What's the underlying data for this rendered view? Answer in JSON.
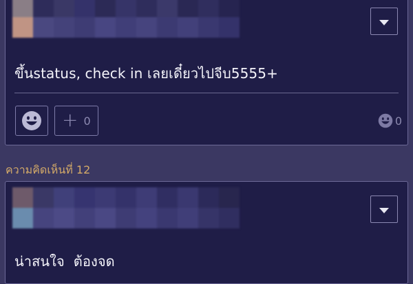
{
  "comment_1": {
    "author_blurred": true,
    "body": "ขึ้นstatus, check in เลยเดี๋ยวไปจีบ5555+",
    "plus_count": "0",
    "reaction_total": "0"
  },
  "comment_2": {
    "label": "ความคิดเห็นที่ 12",
    "author_blurred": true,
    "body": "น่าสนใจ  ต้องจด"
  },
  "icons": {
    "dropdown": "chevron-down-icon",
    "emoji": "smiley-icon",
    "plus": "plus-icon"
  },
  "colors": {
    "page_bg": "#3b3862",
    "card_bg": "#1f1d47",
    "label_gold": "#d4aa68"
  }
}
